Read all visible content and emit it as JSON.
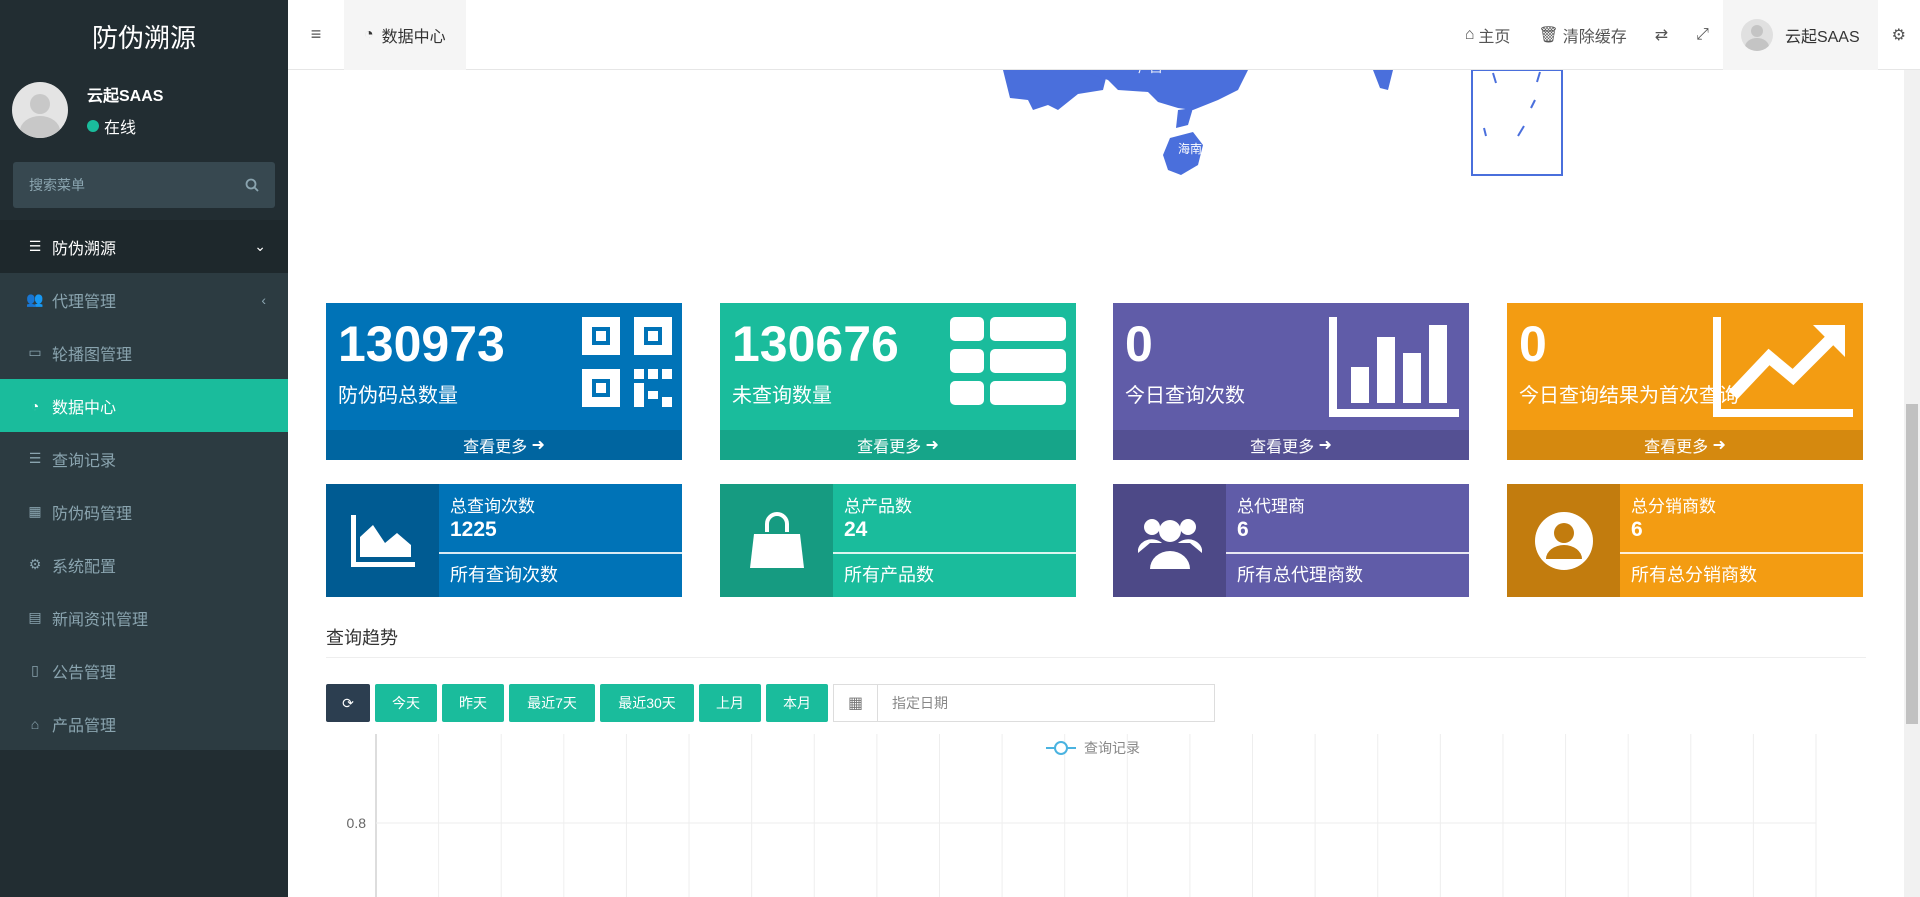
{
  "sidebar": {
    "title": "防伪溯源",
    "user_name": "云起SAAS",
    "user_status": "在线",
    "search_placeholder": "搜索菜单",
    "items": [
      {
        "label": "防伪溯源",
        "icon": "list-icon"
      },
      {
        "label": "代理管理",
        "icon": "users-icon"
      },
      {
        "label": "轮播图管理",
        "icon": "image-icon"
      },
      {
        "label": "数据中心",
        "icon": "dashboard-icon"
      },
      {
        "label": "查询记录",
        "icon": "list-icon"
      },
      {
        "label": "防伪码管理",
        "icon": "qrcode-icon"
      },
      {
        "label": "系统配置",
        "icon": "gear-icon"
      },
      {
        "label": "新闻资讯管理",
        "icon": "newspaper-icon"
      },
      {
        "label": "公告管理",
        "icon": "file-icon"
      },
      {
        "label": "产品管理",
        "icon": "shopping-bag-icon"
      }
    ]
  },
  "topbar": {
    "active_tab": "数据中心",
    "home": "主页",
    "clear_cache": "清除缓存",
    "user": "云起SAAS"
  },
  "cards": [
    {
      "value": "130973",
      "label": "防伪码总数量",
      "more": "查看更多",
      "color": "#0073b7"
    },
    {
      "value": "130676",
      "label": "未查询数量",
      "more": "查看更多",
      "color": "#1abc9c"
    },
    {
      "value": "0",
      "label": "今日查询次数",
      "more": "查看更多",
      "color": "#605ca8"
    },
    {
      "value": "0",
      "label": "今日查询结果为首次查询",
      "more": "查看更多",
      "color": "#f39c12"
    }
  ],
  "boxes": [
    {
      "title": "总查询次数",
      "value": "1225",
      "desc": "所有查询次数",
      "color": "#0073b7",
      "icon_color": "#005b92"
    },
    {
      "title": "总产品数",
      "value": "24",
      "desc": "所有产品数",
      "color": "#1abc9c",
      "icon_color": "#169b81"
    },
    {
      "title": "总代理商",
      "value": "6",
      "desc": "所有总代理商数",
      "color": "#605ca8",
      "icon_color": "#4d4987"
    },
    {
      "title": "总分销商数",
      "value": "6",
      "desc": "所有总分销商数",
      "color": "#f39c12",
      "icon_color": "#c27c0e"
    }
  ],
  "trend": {
    "title": "查询趋势",
    "buttons": [
      "今天",
      "昨天",
      "最近7天",
      "最近30天",
      "上月",
      "本月"
    ],
    "date_placeholder": "指定日期"
  },
  "chart_data": {
    "type": "line",
    "series": [
      {
        "name": "查询记录",
        "values": []
      }
    ],
    "y_ticks": [
      "0.8"
    ],
    "grid": true,
    "legend": "top-center"
  },
  "map_labels": [
    "广西",
    "海南"
  ]
}
